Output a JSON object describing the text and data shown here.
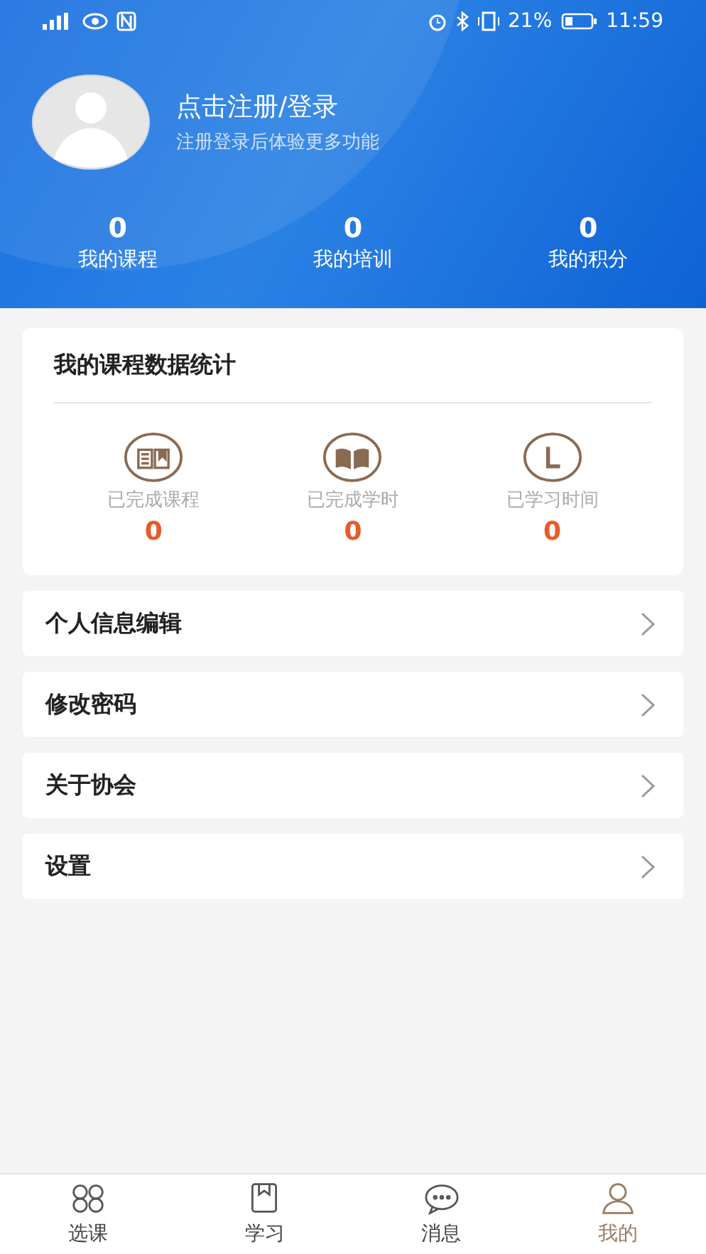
{
  "status_bar": {
    "battery_text": "21%",
    "time": "11:59"
  },
  "profile": {
    "title": "点击注册/登录",
    "subtitle": "注册登录后体验更多功能"
  },
  "counters": [
    {
      "value": "0",
      "label": "我的课程"
    },
    {
      "value": "0",
      "label": "我的培训"
    },
    {
      "value": "0",
      "label": "我的积分"
    }
  ],
  "stats_card": {
    "title": "我的课程数据统计",
    "items": [
      {
        "kind": "course",
        "label": "已完成课程",
        "value": "0"
      },
      {
        "kind": "hours",
        "label": "已完成学时",
        "value": "0"
      },
      {
        "kind": "time",
        "label": "已学习时间",
        "value": "0"
      }
    ]
  },
  "menu": [
    {
      "label": "个人信息编辑"
    },
    {
      "label": "修改密码"
    },
    {
      "label": "关于协会"
    },
    {
      "label": "设置"
    }
  ],
  "tabs": [
    {
      "kind": "grid",
      "label": "选课",
      "selected": false
    },
    {
      "kind": "study",
      "label": "学习",
      "selected": false
    },
    {
      "kind": "chat",
      "label": "消息",
      "selected": false
    },
    {
      "kind": "person",
      "label": "我的",
      "selected": true
    }
  ]
}
